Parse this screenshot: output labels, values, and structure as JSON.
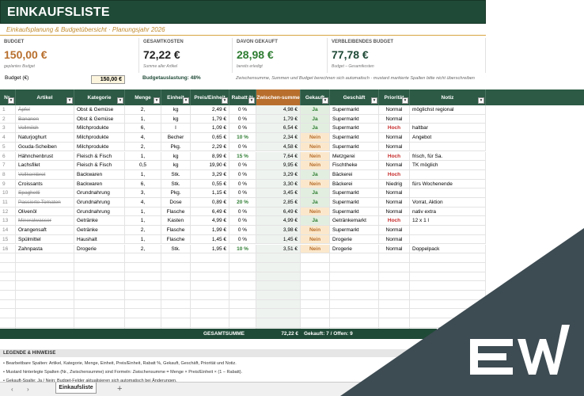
{
  "title": "EINKAUFSLISTE",
  "subtitle": "Einkaufsplanung & Budgetübersicht",
  "subtitle_sep": "·",
  "subtitle_year": "Planungsjahr 2026",
  "kpis": [
    {
      "label": "BUDGET",
      "value": "150,00 €",
      "note": "geplantes Budget",
      "color": "#b86f2d"
    },
    {
      "label": "GESAMTKOSTEN",
      "value": "72,22 €",
      "note": "Summe aller Artikel",
      "color": "#222222"
    },
    {
      "label": "DAVON GEKAUFT",
      "value": "28,98 €",
      "note": "bereits erledigt",
      "color": "#2e7d32"
    },
    {
      "label": "VERBLEIBENDES BUDGET",
      "value": "77,78 €",
      "note": "Budget – Gesamtkosten",
      "color": "#1f4a37"
    }
  ],
  "budget_row": {
    "label": "Budget (€)",
    "input": "150,00 €",
    "usage": "Budgetauslastung:  48%",
    "hint": "Zwischensumme, Summen und Budget berechnen sich automatisch · mustard markierte Spalten bitte nicht überschreiben"
  },
  "columns": [
    "Nr.",
    "Artikel",
    "Kategorie",
    "Menge",
    "Einheit",
    "Preis/Einheit",
    "Rabatt %",
    "Zwischen-summe",
    "Gekauft",
    "Geschäft",
    "Priorität",
    "Notiz"
  ],
  "rows": [
    {
      "nr": "1",
      "artikel": "Äpfel",
      "kat": "Obst & Gemüse",
      "menge": "2,",
      "einheit": "kg",
      "preis": "2,49 €",
      "rabatt": "0 %",
      "zw": "4,98 €",
      "gekauft": "Ja",
      "geschaeft": "Supermarkt",
      "prio": "Normal",
      "notiz": "möglichst regional"
    },
    {
      "nr": "2",
      "artikel": "Bananen",
      "kat": "Obst & Gemüse",
      "menge": "1,",
      "einheit": "kg",
      "preis": "1,79 €",
      "rabatt": "0 %",
      "zw": "1,79 €",
      "gekauft": "Ja",
      "geschaeft": "Supermarkt",
      "prio": "Normal",
      "notiz": ""
    },
    {
      "nr": "3",
      "artikel": "Vollmilch",
      "kat": "Milchprodukte",
      "menge": "6,",
      "einheit": "l",
      "preis": "1,09 €",
      "rabatt": "0 %",
      "zw": "6,54 €",
      "gekauft": "Ja",
      "geschaeft": "Supermarkt",
      "prio": "Hoch",
      "notiz": "haltbar"
    },
    {
      "nr": "4",
      "artikel": "Naturjoghurt",
      "kat": "Milchprodukte",
      "menge": "4,",
      "einheit": "Becher",
      "preis": "0,65 €",
      "rabatt": "10 %",
      "zw": "2,34 €",
      "gekauft": "Nein",
      "geschaeft": "Supermarkt",
      "prio": "Normal",
      "notiz": "Angebot"
    },
    {
      "nr": "5",
      "artikel": "Gouda-Scheiben",
      "kat": "Milchprodukte",
      "menge": "2,",
      "einheit": "Pkg.",
      "preis": "2,29 €",
      "rabatt": "0 %",
      "zw": "4,58 €",
      "gekauft": "Nein",
      "geschaeft": "Supermarkt",
      "prio": "Normal",
      "notiz": ""
    },
    {
      "nr": "6",
      "artikel": "Hähnchenbrust",
      "kat": "Fleisch & Fisch",
      "menge": "1,",
      "einheit": "kg",
      "preis": "8,99 €",
      "rabatt": "15 %",
      "zw": "7,64 €",
      "gekauft": "Nein",
      "geschaeft": "Metzgerei",
      "prio": "Hoch",
      "notiz": "frisch, für Sa."
    },
    {
      "nr": "7",
      "artikel": "Lachsfilet",
      "kat": "Fleisch & Fisch",
      "menge": "0,5",
      "einheit": "kg",
      "preis": "19,90 €",
      "rabatt": "0 %",
      "zw": "9,95 €",
      "gekauft": "Nein",
      "geschaeft": "Fischtheke",
      "prio": "Normal",
      "notiz": "TK möglich"
    },
    {
      "nr": "8",
      "artikel": "Vollkornbrot",
      "kat": "Backwaren",
      "menge": "1,",
      "einheit": "Stk.",
      "preis": "3,29 €",
      "rabatt": "0 %",
      "zw": "3,29 €",
      "gekauft": "Ja",
      "geschaeft": "Bäckerei",
      "prio": "Hoch",
      "notiz": ""
    },
    {
      "nr": "9",
      "artikel": "Croissants",
      "kat": "Backwaren",
      "menge": "6,",
      "einheit": "Stk.",
      "preis": "0,55 €",
      "rabatt": "0 %",
      "zw": "3,30 €",
      "gekauft": "Nein",
      "geschaeft": "Bäckerei",
      "prio": "Niedrig",
      "notiz": "fürs Wochenende"
    },
    {
      "nr": "10",
      "artikel": "Spaghetti",
      "kat": "Grundnahrung",
      "menge": "3,",
      "einheit": "Pkg.",
      "preis": "1,15 €",
      "rabatt": "0 %",
      "zw": "3,45 €",
      "gekauft": "Ja",
      "geschaeft": "Supermarkt",
      "prio": "Normal",
      "notiz": ""
    },
    {
      "nr": "11",
      "artikel": "Passierte Tomaten",
      "kat": "Grundnahrung",
      "menge": "4,",
      "einheit": "Dose",
      "preis": "0,89 €",
      "rabatt": "20 %",
      "zw": "2,85 €",
      "gekauft": "Ja",
      "geschaeft": "Supermarkt",
      "prio": "Normal",
      "notiz": "Vorrat, Aktion"
    },
    {
      "nr": "12",
      "artikel": "Olivenöl",
      "kat": "Grundnahrung",
      "menge": "1,",
      "einheit": "Flasche",
      "preis": "6,49 €",
      "rabatt": "0 %",
      "zw": "6,49 €",
      "gekauft": "Nein",
      "geschaeft": "Supermarkt",
      "prio": "Normal",
      "notiz": "nativ extra"
    },
    {
      "nr": "13",
      "artikel": "Mineralwasser",
      "kat": "Getränke",
      "menge": "1,",
      "einheit": "Kasten",
      "preis": "4,99 €",
      "rabatt": "0 %",
      "zw": "4,99 €",
      "gekauft": "Ja",
      "geschaeft": "Getränkemarkt",
      "prio": "Hoch",
      "notiz": "12 x 1 l"
    },
    {
      "nr": "14",
      "artikel": "Orangensaft",
      "kat": "Getränke",
      "menge": "2,",
      "einheit": "Flasche",
      "preis": "1,99 €",
      "rabatt": "0 %",
      "zw": "3,98 €",
      "gekauft": "Nein",
      "geschaeft": "Supermarkt",
      "prio": "Normal",
      "notiz": ""
    },
    {
      "nr": "15",
      "artikel": "Spülmittel",
      "kat": "Haushalt",
      "menge": "1,",
      "einheit": "Flasche",
      "preis": "1,45 €",
      "rabatt": "0 %",
      "zw": "1,45 €",
      "gekauft": "Nein",
      "geschaeft": "Drogerie",
      "prio": "Normal",
      "notiz": ""
    },
    {
      "nr": "16",
      "artikel": "Zahnpasta",
      "kat": "Drogerie",
      "menge": "2,",
      "einheit": "Stk.",
      "preis": "1,95 €",
      "rabatt": "10 %",
      "zw": "3,51 €",
      "gekauft": "Nein",
      "geschaeft": "Drogerie",
      "prio": "Normal",
      "notiz": "Doppelpack"
    }
  ],
  "total": {
    "label": "GESAMTSUMME",
    "value": "72,22 €",
    "status": "Gekauft: 7  /  Offen: 9"
  },
  "legend": {
    "title": "LEGENDE & HINWEISE",
    "lines": [
      "• Bearbeitbare Spalten: Artikel, Kategorie, Menge, Einheit, Preis/Einheit, Rabatt %, Gekauft, Geschäft, Priorität und Notiz.",
      "• Mustard hinterlegte Spalten (Nr., Zwischensumme) sind Formeln:  Zwischensumme = Menge × Preis/Einheit × (1 − Rabatt).",
      "• Gekauft-Spalte: Ja / Nein; Budget-Felder aktualisieren sich automatisch bei Änderungen."
    ]
  },
  "sheet_tab": "Einkaufsliste",
  "add_sheet": "+"
}
